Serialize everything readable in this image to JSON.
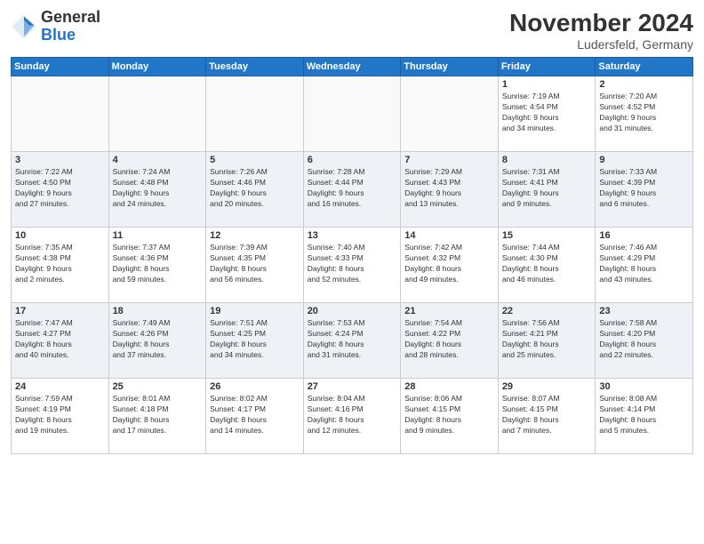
{
  "header": {
    "logo": {
      "general": "General",
      "blue": "Blue"
    },
    "title": "November 2024",
    "location": "Ludersfeld, Germany"
  },
  "calendar": {
    "days_of_week": [
      "Sunday",
      "Monday",
      "Tuesday",
      "Wednesday",
      "Thursday",
      "Friday",
      "Saturday"
    ],
    "weeks": [
      {
        "days": [
          {
            "num": "",
            "info": ""
          },
          {
            "num": "",
            "info": ""
          },
          {
            "num": "",
            "info": ""
          },
          {
            "num": "",
            "info": ""
          },
          {
            "num": "",
            "info": ""
          },
          {
            "num": "1",
            "info": "Sunrise: 7:19 AM\nSunset: 4:54 PM\nDaylight: 9 hours\nand 34 minutes."
          },
          {
            "num": "2",
            "info": "Sunrise: 7:20 AM\nSunset: 4:52 PM\nDaylight: 9 hours\nand 31 minutes."
          }
        ]
      },
      {
        "days": [
          {
            "num": "3",
            "info": "Sunrise: 7:22 AM\nSunset: 4:50 PM\nDaylight: 9 hours\nand 27 minutes."
          },
          {
            "num": "4",
            "info": "Sunrise: 7:24 AM\nSunset: 4:48 PM\nDaylight: 9 hours\nand 24 minutes."
          },
          {
            "num": "5",
            "info": "Sunrise: 7:26 AM\nSunset: 4:46 PM\nDaylight: 9 hours\nand 20 minutes."
          },
          {
            "num": "6",
            "info": "Sunrise: 7:28 AM\nSunset: 4:44 PM\nDaylight: 9 hours\nand 16 minutes."
          },
          {
            "num": "7",
            "info": "Sunrise: 7:29 AM\nSunset: 4:43 PM\nDaylight: 9 hours\nand 13 minutes."
          },
          {
            "num": "8",
            "info": "Sunrise: 7:31 AM\nSunset: 4:41 PM\nDaylight: 9 hours\nand 9 minutes."
          },
          {
            "num": "9",
            "info": "Sunrise: 7:33 AM\nSunset: 4:39 PM\nDaylight: 9 hours\nand 6 minutes."
          }
        ]
      },
      {
        "days": [
          {
            "num": "10",
            "info": "Sunrise: 7:35 AM\nSunset: 4:38 PM\nDaylight: 9 hours\nand 2 minutes."
          },
          {
            "num": "11",
            "info": "Sunrise: 7:37 AM\nSunset: 4:36 PM\nDaylight: 8 hours\nand 59 minutes."
          },
          {
            "num": "12",
            "info": "Sunrise: 7:39 AM\nSunset: 4:35 PM\nDaylight: 8 hours\nand 56 minutes."
          },
          {
            "num": "13",
            "info": "Sunrise: 7:40 AM\nSunset: 4:33 PM\nDaylight: 8 hours\nand 52 minutes."
          },
          {
            "num": "14",
            "info": "Sunrise: 7:42 AM\nSunset: 4:32 PM\nDaylight: 8 hours\nand 49 minutes."
          },
          {
            "num": "15",
            "info": "Sunrise: 7:44 AM\nSunset: 4:30 PM\nDaylight: 8 hours\nand 46 minutes."
          },
          {
            "num": "16",
            "info": "Sunrise: 7:46 AM\nSunset: 4:29 PM\nDaylight: 8 hours\nand 43 minutes."
          }
        ]
      },
      {
        "days": [
          {
            "num": "17",
            "info": "Sunrise: 7:47 AM\nSunset: 4:27 PM\nDaylight: 8 hours\nand 40 minutes."
          },
          {
            "num": "18",
            "info": "Sunrise: 7:49 AM\nSunset: 4:26 PM\nDaylight: 8 hours\nand 37 minutes."
          },
          {
            "num": "19",
            "info": "Sunrise: 7:51 AM\nSunset: 4:25 PM\nDaylight: 8 hours\nand 34 minutes."
          },
          {
            "num": "20",
            "info": "Sunrise: 7:53 AM\nSunset: 4:24 PM\nDaylight: 8 hours\nand 31 minutes."
          },
          {
            "num": "21",
            "info": "Sunrise: 7:54 AM\nSunset: 4:22 PM\nDaylight: 8 hours\nand 28 minutes."
          },
          {
            "num": "22",
            "info": "Sunrise: 7:56 AM\nSunset: 4:21 PM\nDaylight: 8 hours\nand 25 minutes."
          },
          {
            "num": "23",
            "info": "Sunrise: 7:58 AM\nSunset: 4:20 PM\nDaylight: 8 hours\nand 22 minutes."
          }
        ]
      },
      {
        "days": [
          {
            "num": "24",
            "info": "Sunrise: 7:59 AM\nSunset: 4:19 PM\nDaylight: 8 hours\nand 19 minutes."
          },
          {
            "num": "25",
            "info": "Sunrise: 8:01 AM\nSunset: 4:18 PM\nDaylight: 8 hours\nand 17 minutes."
          },
          {
            "num": "26",
            "info": "Sunrise: 8:02 AM\nSunset: 4:17 PM\nDaylight: 8 hours\nand 14 minutes."
          },
          {
            "num": "27",
            "info": "Sunrise: 8:04 AM\nSunset: 4:16 PM\nDaylight: 8 hours\nand 12 minutes."
          },
          {
            "num": "28",
            "info": "Sunrise: 8:06 AM\nSunset: 4:15 PM\nDaylight: 8 hours\nand 9 minutes."
          },
          {
            "num": "29",
            "info": "Sunrise: 8:07 AM\nSunset: 4:15 PM\nDaylight: 8 hours\nand 7 minutes."
          },
          {
            "num": "30",
            "info": "Sunrise: 8:08 AM\nSunset: 4:14 PM\nDaylight: 8 hours\nand 5 minutes."
          }
        ]
      }
    ]
  }
}
